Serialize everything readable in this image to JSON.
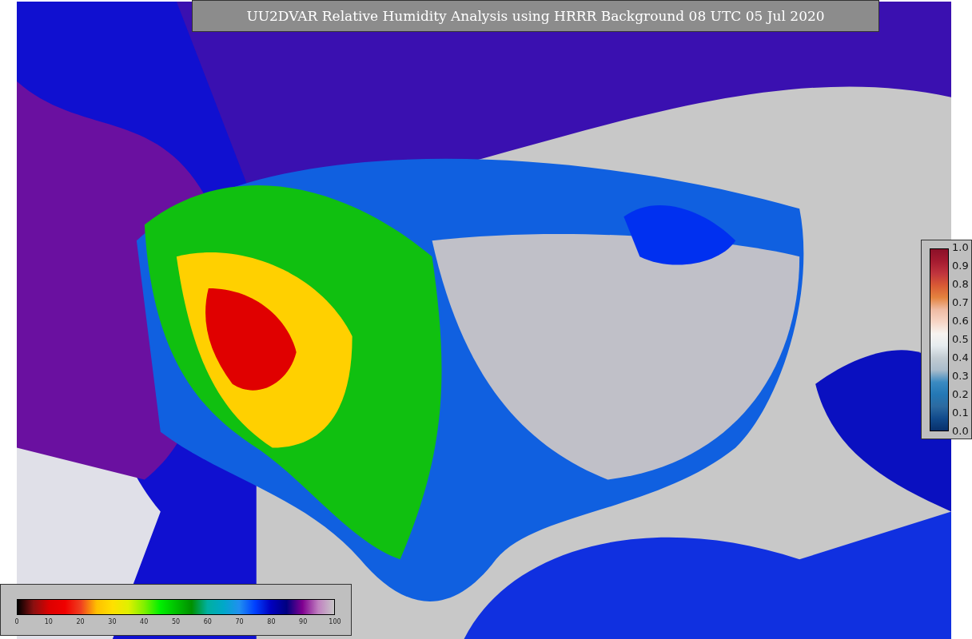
{
  "title": "UU2DVAR Relative Humidity Analysis using HRRR Background 08 UTC 05 Jul 2020",
  "humidity_colorbar": {
    "ticks": [
      "0",
      "10",
      "20",
      "30",
      "40",
      "50",
      "60",
      "70",
      "80",
      "90",
      "100"
    ]
  },
  "ratio_colorbar": {
    "ticks": [
      "1.0",
      "0.9",
      "0.8",
      "0.7",
      "0.6",
      "0.5",
      "0.4",
      "0.3",
      "0.2",
      "0.1",
      "0.0"
    ]
  }
}
